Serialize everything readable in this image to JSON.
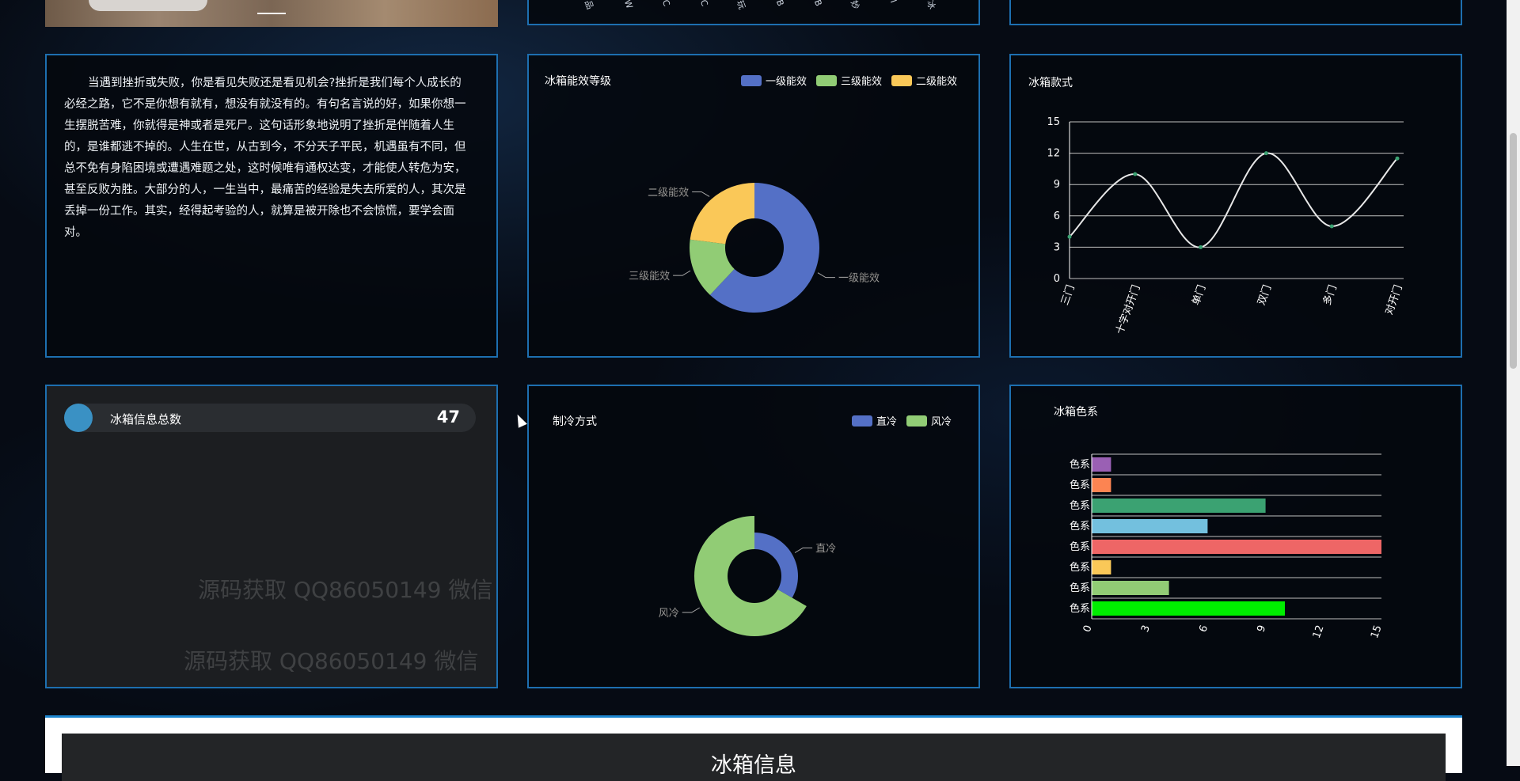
{
  "essay": "当遇到挫折或失败，你是看见失败还是看见机会?挫折是我们每个人成长的必经之路，它不是你想有就有，想没有就没有的。有句名言说的好，如果你想一生摆脱苦难，你就得是神或者是死尸。这句话形象地说明了挫折是伴随着人生的，是谁都逃不掉的。人生在世，从古到今，不分天子平民，机遇虽有不同，但总不免有身陷困境或遭遇难题之处，这时候唯有通权达变，才能使人转危为安，甚至反败为胜。大部分的人，一生当中，最痛苦的经验是失去所爱的人，其次是丢掉一份工作。其实，经得起考验的人，就算是被开除也不会惊慌，要学会面对。",
  "top_ticks": [
    "品",
    "W",
    "C",
    "C",
    "玩",
    "B",
    "B",
    "妙",
    "I",
    "冰"
  ],
  "stat": {
    "label": "冰箱信息总数",
    "value": "47"
  },
  "section_title": "冰箱信息",
  "watermark": "源码获取 QQ86050149 微信",
  "colors": {
    "panel_border": "#1d6fb0",
    "blue": "#5470c6",
    "green": "#91cc75",
    "yellow": "#fac858",
    "red": "#ee6666",
    "sky": "#73c0de",
    "teal": "#3ba272",
    "orange": "#fc8452",
    "purple": "#9a60b4",
    "lime": "#00ee00"
  },
  "chart_data": [
    {
      "type": "pie",
      "title": "冰箱能效等级",
      "legend": [
        "一级能效",
        "三级能效",
        "二级能效"
      ],
      "categories": [
        "一级能效",
        "三级能效",
        "二级能效"
      ],
      "values": [
        62,
        15,
        23
      ],
      "legend_placement": "top-right"
    },
    {
      "type": "line",
      "title": "冰箱款式",
      "categories": [
        "三门",
        "十字对开门",
        "单门",
        "双门",
        "多门",
        "对开门"
      ],
      "values": [
        4,
        10,
        3,
        12,
        5,
        11.5
      ],
      "ylim": [
        0,
        15
      ],
      "yticks": [
        0,
        3,
        6,
        9,
        12,
        15
      ],
      "grid": true
    },
    {
      "type": "pie",
      "title": "制冷方式",
      "legend": [
        "直冷",
        "风冷"
      ],
      "categories": [
        "直冷",
        "风冷"
      ],
      "values": [
        25,
        50
      ],
      "legend_placement": "top-right"
    },
    {
      "type": "bar",
      "title": "冰箱色系",
      "orientation": "horizontal",
      "categories": [
        "色系",
        "色系",
        "色系",
        "色系",
        "色系",
        "色系",
        "色系",
        "色系"
      ],
      "values": [
        10,
        4,
        1,
        15,
        6,
        9,
        1,
        1
      ],
      "xlim": [
        0,
        15
      ],
      "xticks": [
        0,
        3,
        6,
        9,
        12,
        15
      ],
      "grid": true
    }
  ]
}
